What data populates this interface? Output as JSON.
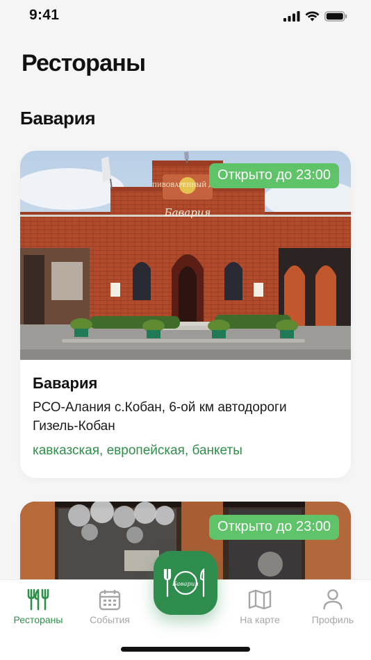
{
  "status": {
    "time": "9:41"
  },
  "page": {
    "title": "Рестораны"
  },
  "section": {
    "title": "Бавария"
  },
  "restaurants": [
    {
      "name": "Бавария",
      "badge": "Открыто до 23:00",
      "address": "РСО-Алания с.Кобан, 6-ой км автодороги Гизель-Кобан",
      "tags": "кавказская, европейская, банкеты",
      "sign_top": "ПИВОВАРЕННЫЙ ДОМ",
      "sign_main": "Бавария"
    },
    {
      "badge": "Открыто до 23:00"
    }
  ],
  "tabbar": {
    "items": [
      {
        "label": "Рестораны",
        "icon": "fork-knife-icon",
        "active": true
      },
      {
        "label": "События",
        "icon": "calendar-icon",
        "active": false
      },
      {
        "label": "На карте",
        "icon": "map-icon",
        "active": false
      },
      {
        "label": "Профиль",
        "icon": "profile-icon",
        "active": false
      }
    ],
    "center_logo": "Бавария"
  },
  "colors": {
    "accent": "#2e8d4c",
    "badge": "#5fc369",
    "tags": "#2f8f4a",
    "inactive": "#a6a6a6"
  }
}
